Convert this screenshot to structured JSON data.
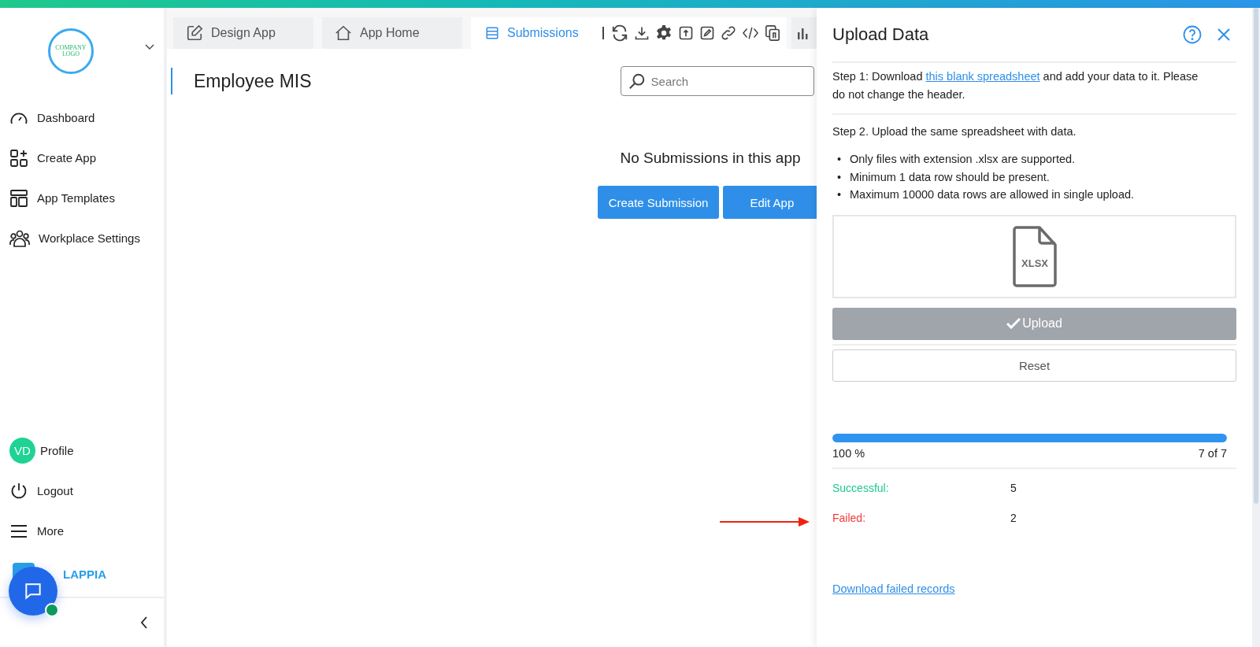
{
  "sidebar": {
    "logo": {
      "line1": "COMPANY",
      "line2": "LOGO"
    },
    "items": [
      {
        "label": "Dashboard",
        "kind": "dashboard"
      },
      {
        "label": "Create App",
        "kind": "create"
      },
      {
        "label": "App Templates",
        "kind": "templates"
      },
      {
        "label": "Workplace Settings",
        "kind": "people"
      }
    ],
    "profile": {
      "initials": "VD",
      "label": "Profile"
    },
    "bottom_items": [
      {
        "label": "Logout",
        "kind": "power"
      },
      {
        "label": "More",
        "kind": "menu"
      }
    ],
    "brand": "LAPPIA"
  },
  "tabs": [
    {
      "label": "Design App",
      "kind": "edit",
      "selected": false
    },
    {
      "label": "App Home",
      "kind": "home",
      "selected": false
    },
    {
      "label": "Submissions",
      "kind": "list",
      "selected": true
    }
  ],
  "app_title": "Employee MIS",
  "search": {
    "placeholder": "Search"
  },
  "empty_message": "No Submissions in this app",
  "buttons": [
    "Create Submission",
    "Edit App"
  ],
  "panel": {
    "title": "Upload Data",
    "step1": {
      "before": "Step 1: Download ",
      "link": "this blank spreadsheet",
      "after": " and add your data to it. Please do not change the header."
    },
    "step2": "Step 2. Upload the same spreadsheet with data.",
    "rule_marker": "•",
    "rules": [
      "Only files with extension .xlsx are supported.",
      "Minimum 1 data row should be present.",
      "Maximum 10000 data rows are allowed in single upload."
    ],
    "file_label": "XLSX",
    "upload_button": {
      "label": "Upload",
      "disabled": true
    },
    "reset_button": "Reset",
    "progress": {
      "level": 1.0,
      "percent": "100 %",
      "count": "7 of 7"
    },
    "stats": [
      {
        "label": "Successful:",
        "value": "5",
        "kind": "success"
      },
      {
        "label": "Failed:",
        "value": "2",
        "kind": "failed"
      }
    ],
    "failed_link": "Download failed records"
  }
}
